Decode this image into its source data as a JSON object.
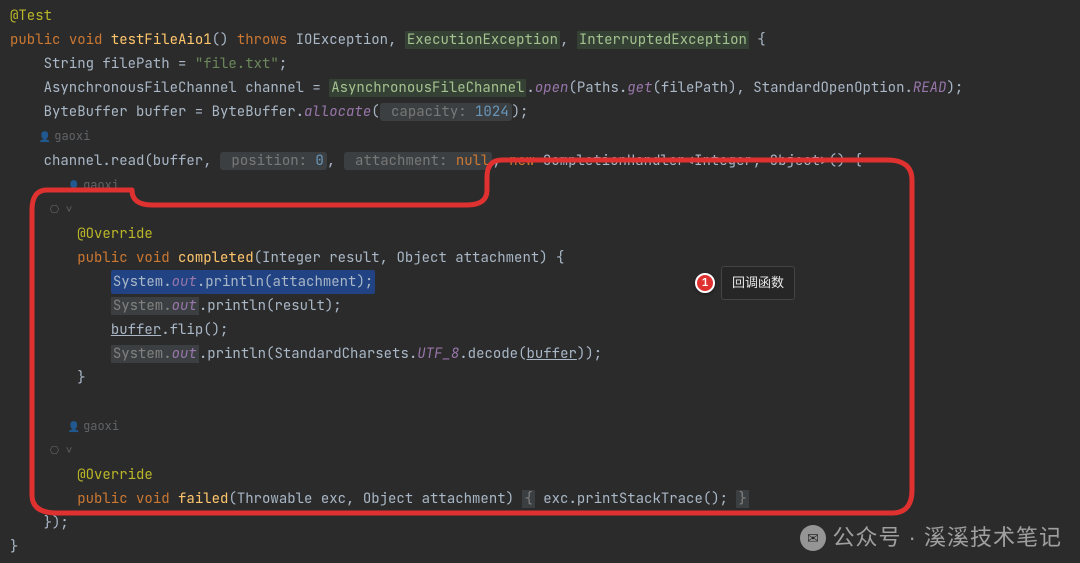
{
  "code": {
    "ann_test": "@Test",
    "kw_public": "public",
    "kw_void": "void",
    "kw_throws": "throws",
    "kw_new": "new",
    "kw_null": "null",
    "fn_main": "testFileAio1",
    "exc_io": "IOException",
    "exc_exec": "ExecutionException",
    "exc_int": "InterruptedException",
    "l3": "String filePath = ",
    "l3_str": "\"file.txt\"",
    "l4_a": "AsynchronousFileChannel channel = ",
    "l4_b": "AsynchronousFileChannel",
    "l4_open": "open",
    "l4_paths": "Paths",
    "l4_get": "get",
    "l4_arg": "filePath",
    "l4_soo": "StandardOpenOption",
    "l4_read": "READ",
    "l5_a": "ByteBuffer buffer = ByteBuffer.",
    "l5_alloc": "allocate",
    "hint_cap": " capacity: ",
    "num_1024": "1024",
    "author": "gaoxi",
    "l7_a": "channel.read(buffer, ",
    "hint_pos": " position: ",
    "num_0": "0",
    "hint_att": " attachment: ",
    "l7_ch": "CompletionHandler<Integer, Object>() {",
    "ann_override": "@Override",
    "fn_completed": "completed",
    "sig_completed": "(Integer result, Object attachment) {",
    "sysout_att": "System",
    "out": "out",
    "println": "println",
    "arg_att": "attachment",
    "arg_res": "result",
    "buffer": "buffer",
    "flip": "flip",
    "sc": "StandardCharsets",
    "utf8": "UTF_8",
    "decode": "decode",
    "fn_failed": "failed",
    "sig_failed": "(Throwable exc, Object attachment) ",
    "body_failed": " exc.printStackTrace(); ",
    "close_anon": "});",
    "close_fn": "}"
  },
  "callout": {
    "num": "1",
    "label": "回调函数"
  },
  "watermark": "公众号 · 溪溪技术笔记"
}
